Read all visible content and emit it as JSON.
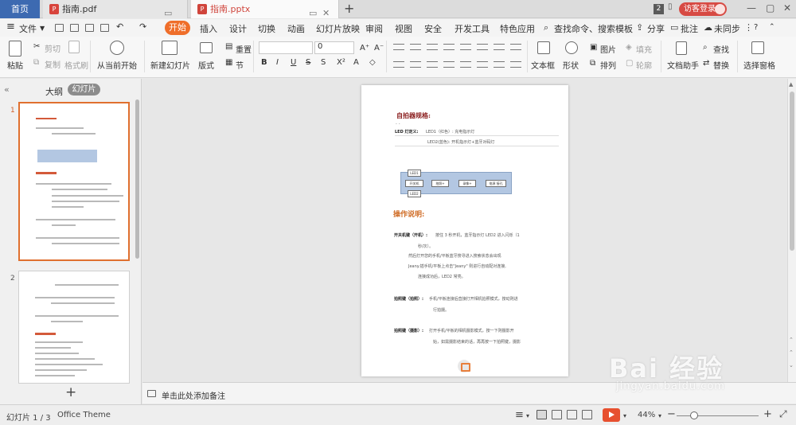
{
  "titlebar": {
    "home_tab": "首页",
    "tabs": [
      {
        "label": "指南.pdf",
        "icon": "pdf-file-icon"
      },
      {
        "label": "指南.pptx",
        "icon": "pptx-file-icon"
      }
    ],
    "window_count": "2",
    "login_label": "访客登录"
  },
  "menubar": {
    "file_label": "文件",
    "tabs": [
      "开始",
      "插入",
      "设计",
      "切换",
      "动画",
      "幻灯片放映",
      "审阅",
      "视图",
      "安全",
      "开发工具",
      "特色应用"
    ],
    "search_label": "查找命令、搜索模板",
    "share_label": "分享",
    "comment_label": "批注",
    "sync_label": "未同步"
  },
  "ribbon": {
    "paste": "粘贴",
    "cut": "剪切",
    "copy": "复制",
    "format_painter": "格式刷",
    "from_start": "从当前开始",
    "new_slide": "新建幻灯片",
    "layout": "版式",
    "section": "节",
    "reset": "重置",
    "font_size": "0",
    "textbox": "文本框",
    "shape": "形状",
    "picture": "图片",
    "fill": "填充",
    "arrange": "排列",
    "outline": "轮廓",
    "doc_helper": "文档助手",
    "find": "查找",
    "replace": "替换",
    "select_pane": "选择窗格"
  },
  "left_panel": {
    "outline_tab": "大纲",
    "slides_tab": "幻灯片",
    "slide_numbers": [
      "1",
      "2"
    ]
  },
  "slide": {
    "heading1": "自拍器规格:",
    "led_label": "LED 灯定义:",
    "led1_line": "LED1（红色）: 充电指示灯",
    "led2_line": "LED2(蓝色): 开机指示灯+蓝牙对码灯",
    "diagram": {
      "led1": "LED1",
      "led2": "LED2",
      "switch": "开关机",
      "photo": "拍照+",
      "video": "录像+",
      "power": "电源 接孔"
    },
    "heading2": "操作说明:",
    "para1_label": "开关机键（开机）:",
    "para1_text": "按住 3 秒开机，蓝牙指示灯 LED2 进入闪烁（1",
    "para1_b": "秒/次）。",
    "para1_c": "然后打开您的手机/平板蓝牙搜寻进入搜索状态会出现",
    "para1_d": "Jeany.插手机/平板上点击\"Jeany\" 则进行自动配对连接,",
    "para1_e": "连接成功后，LED2 常亮。",
    "para2_label": "拍照键（拍照）:",
    "para2_text": "手机/平板连接后直接打开相机拍照模式，按动则进",
    "para2_b": "行拍摄。",
    "para3_label": "拍照键（摄影）:",
    "para3_text": "打开手机/平板的相机摄影模式，按一下则摄影开",
    "para3_b": "始，如需摄影结束的话，再再按一下拍照键，摄影"
  },
  "notes": {
    "placeholder": "单击此处添加备注"
  },
  "statusbar": {
    "slide_counter": "幻灯片 1 / 3",
    "theme": "Office Theme",
    "zoom": "44%"
  },
  "watermark": {
    "main": "Bai 经验",
    "sub": "jingyan.baidu.com"
  },
  "colors": {
    "accent_orange": "#ef6e2a",
    "home_tab_blue": "#3d6ab1",
    "login_red": "#d74a43",
    "slide_play_red": "#e7502f"
  }
}
